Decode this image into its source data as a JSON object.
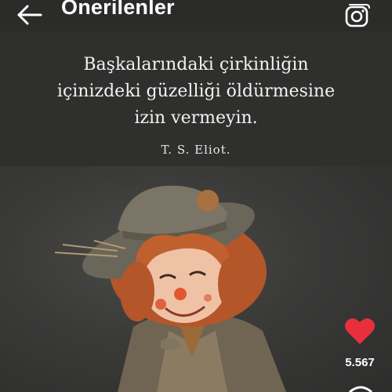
{
  "header": {
    "title": "Önerilenler",
    "back_icon": "arrow-left-icon",
    "camera_icon": "camera-icon"
  },
  "quote": {
    "lines": [
      "Başkalarındaki çirkinliğin",
      "içinizdeki güzelliği öldürmesine",
      "izin vermeyin."
    ],
    "author": "T. S. Eliot."
  },
  "actions": {
    "like_icon": "heart-icon",
    "like_color": "#e8303c",
    "like_count": "5.567"
  },
  "colors": {
    "background": "#2b2b2a",
    "text": "#ffffff"
  }
}
